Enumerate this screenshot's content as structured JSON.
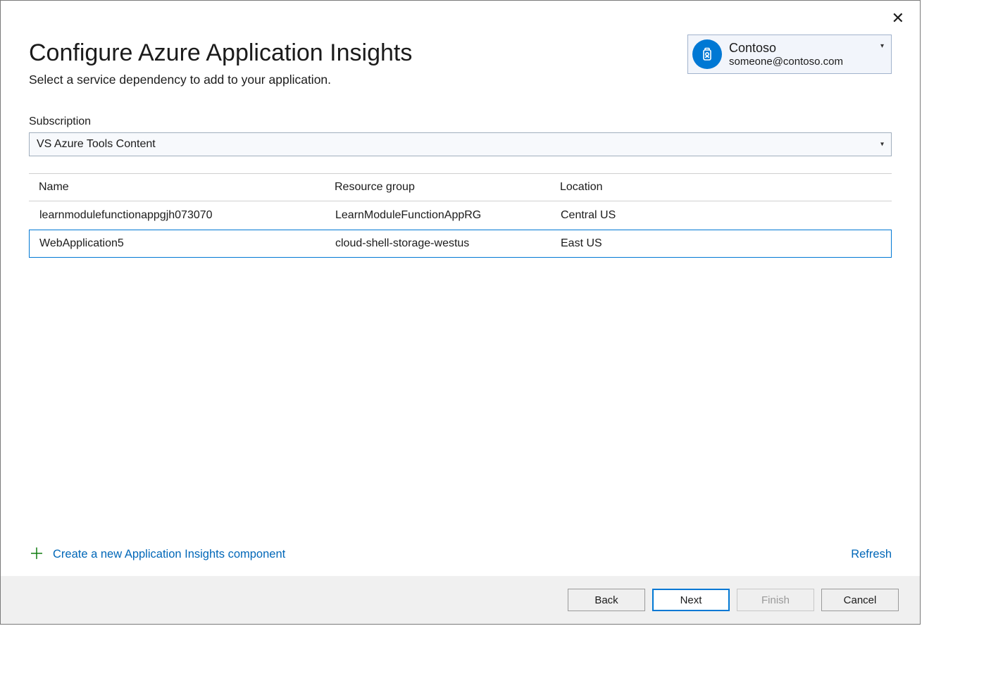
{
  "header": {
    "title": "Configure Azure Application Insights",
    "subtitle": "Select a service dependency to add to your application."
  },
  "account": {
    "name": "Contoso",
    "email": "someone@contoso.com"
  },
  "subscription": {
    "label": "Subscription",
    "selected": "VS Azure Tools Content"
  },
  "table": {
    "headers": {
      "name": "Name",
      "resource_group": "Resource group",
      "location": "Location"
    },
    "rows": [
      {
        "name": "learnmodulefunctionappgjh073070",
        "resource_group": "LearnModuleFunctionAppRG",
        "location": "Central US",
        "selected": false
      },
      {
        "name": "WebApplication5",
        "resource_group": "cloud-shell-storage-westus",
        "location": "East US",
        "selected": true
      }
    ]
  },
  "links": {
    "create": "Create a new Application Insights component",
    "refresh": "Refresh"
  },
  "footer": {
    "back": "Back",
    "next": "Next",
    "finish": "Finish",
    "cancel": "Cancel"
  }
}
